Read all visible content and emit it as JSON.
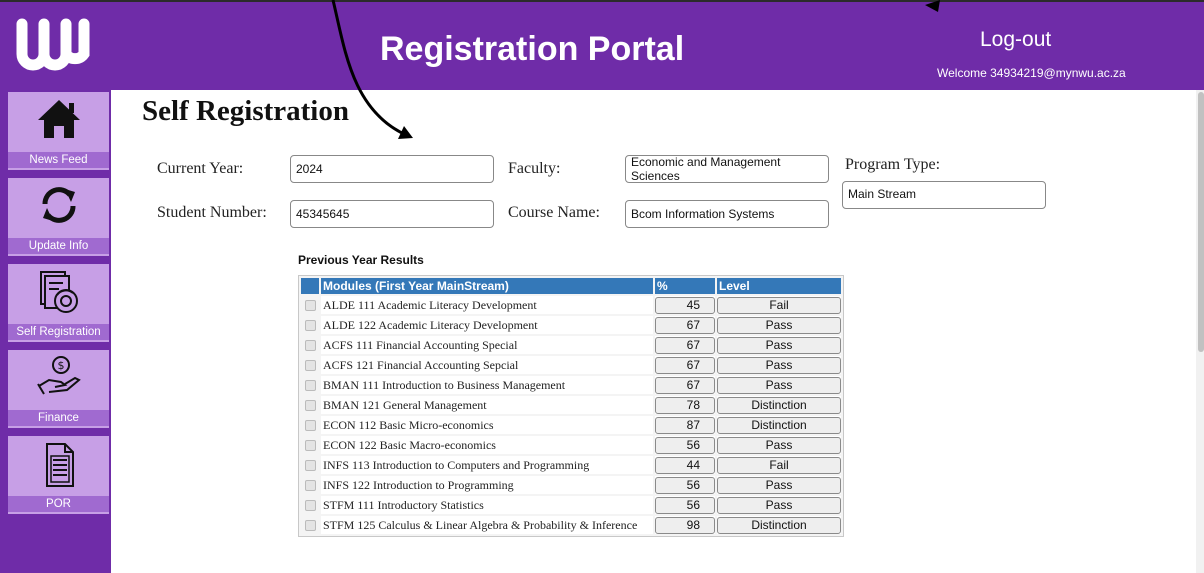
{
  "header": {
    "title": "Registration Portal",
    "logout": "Log-out",
    "welcome": "Welcome 34934219@mynwu.ac.za"
  },
  "sidebar": {
    "items": [
      {
        "label": "News Feed",
        "icon": "home-icon"
      },
      {
        "label": "Update Info",
        "icon": "refresh-icon"
      },
      {
        "label": "Self Registration",
        "icon": "document-gear-icon"
      },
      {
        "label": "Finance",
        "icon": "hand-money-icon"
      },
      {
        "label": "POR",
        "icon": "document-list-icon"
      }
    ]
  },
  "page": {
    "title": "Self Registration"
  },
  "form": {
    "current_year_label": "Current Year:",
    "current_year_value": "2024",
    "student_number_label": "Student Number:",
    "student_number_value": "45345645",
    "faculty_label": "Faculty:",
    "faculty_value": "Economic and Management Sciences",
    "course_label": "Course Name:",
    "course_value": "Bcom Information Systems",
    "program_type_label": "Program Type:",
    "program_type_value": "Main Stream"
  },
  "results": {
    "title": "Previous Year Results",
    "headers": {
      "module": "Modules (First Year MainStream)",
      "percent": "%",
      "level": "Level"
    },
    "rows": [
      {
        "module": "ALDE 111 Academic Literacy Development",
        "percent": "45",
        "level": "Fail"
      },
      {
        "module": "ALDE 122 Academic Literacy Development",
        "percent": "67",
        "level": "Pass"
      },
      {
        "module": "ACFS 111 Financial Accounting Special",
        "percent": "67",
        "level": "Pass"
      },
      {
        "module": "ACFS 121 Financial Accounting Sepcial",
        "percent": "67",
        "level": "Pass"
      },
      {
        "module": "BMAN 111 Introduction to Business Management",
        "percent": "67",
        "level": "Pass"
      },
      {
        "module": "BMAN 121 General Management",
        "percent": "78",
        "level": "Distinction"
      },
      {
        "module": "ECON 112 Basic Micro-economics",
        "percent": "87",
        "level": "Distinction"
      },
      {
        "module": "ECON 122 Basic Macro-economics",
        "percent": "56",
        "level": "Pass"
      },
      {
        "module": "INFS 113 Introduction to Computers and Programming",
        "percent": "44",
        "level": "Fail"
      },
      {
        "module": "INFS 122 Introduction to Programming",
        "percent": "56",
        "level": "Pass"
      },
      {
        "module": "STFM 111 Introductory Statistics",
        "percent": "56",
        "level": "Pass"
      },
      {
        "module": "STFM 125 Calculus & Linear Algebra & Probability & Inference",
        "percent": "98",
        "level": "Distinction"
      }
    ]
  },
  "colors": {
    "primary": "#6f2ca8",
    "nav_item": "#c79fe6",
    "table_header": "#3478b8"
  }
}
